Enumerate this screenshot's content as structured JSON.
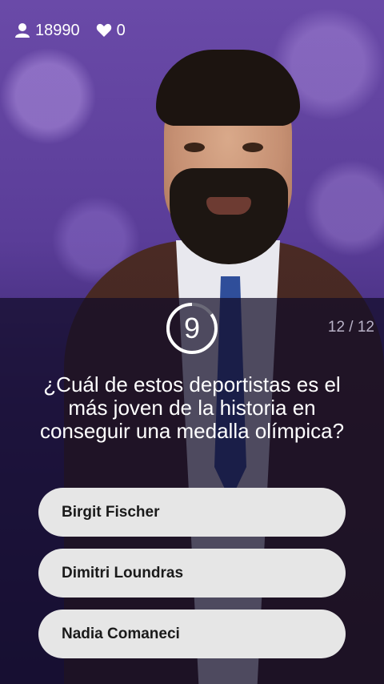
{
  "stats": {
    "players": "18990",
    "players_icon": "user-icon",
    "lives": "0",
    "lives_icon": "heart-icon"
  },
  "timer": {
    "seconds": "9",
    "remaining_fraction": 0.85
  },
  "progress": "12 / 12",
  "question": "¿Cuál de estos deportistas es el más joven de la historia en conseguir una medalla olímpica?",
  "answers": [
    {
      "label": "Birgit Fischer"
    },
    {
      "label": "Dimitri Loundras"
    },
    {
      "label": "Nadia Comaneci"
    }
  ],
  "colors": {
    "answer_bg": "#e6e6e6",
    "background": "#5a3d98",
    "timer_track": "#6b6a78",
    "timer_ring": "#ffffff"
  }
}
